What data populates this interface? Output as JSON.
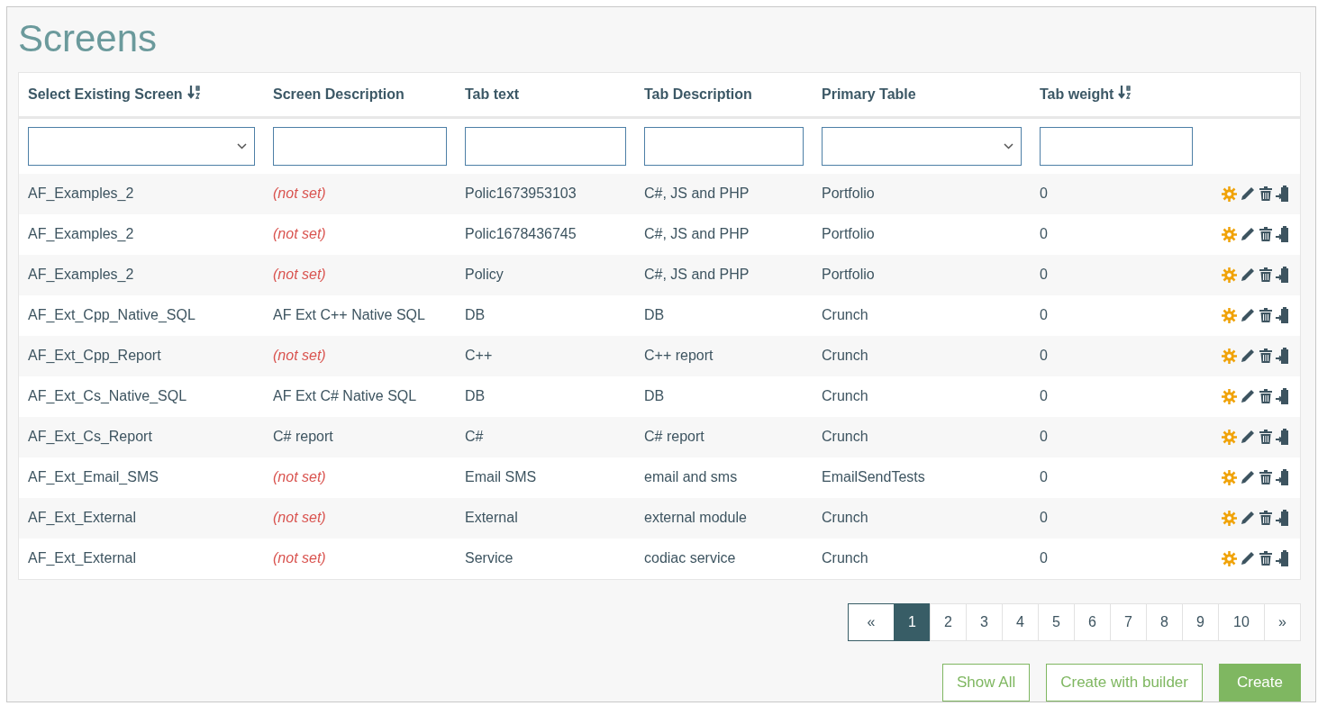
{
  "title": "Screens",
  "columns": [
    {
      "label": "Select Existing Screen",
      "sortable": true,
      "kind": "select"
    },
    {
      "label": "Screen Description",
      "sortable": false,
      "kind": "text"
    },
    {
      "label": "Tab text",
      "sortable": false,
      "kind": "text"
    },
    {
      "label": "Tab Description",
      "sortable": false,
      "kind": "text"
    },
    {
      "label": "Primary Table",
      "sortable": false,
      "kind": "select"
    },
    {
      "label": "Tab weight",
      "sortable": true,
      "kind": "text"
    }
  ],
  "rows": [
    {
      "screen": "AF_Examples_2",
      "description": "(not set)",
      "not_set": true,
      "tab_text": "Polic1673953103",
      "tab_description": "C#, JS and PHP",
      "primary_table": "Portfolio",
      "tab_weight": "0"
    },
    {
      "screen": "AF_Examples_2",
      "description": "(not set)",
      "not_set": true,
      "tab_text": "Polic1678436745",
      "tab_description": "C#, JS and PHP",
      "primary_table": "Portfolio",
      "tab_weight": "0"
    },
    {
      "screen": "AF_Examples_2",
      "description": "(not set)",
      "not_set": true,
      "tab_text": "Policy",
      "tab_description": "C#, JS and PHP",
      "primary_table": "Portfolio",
      "tab_weight": "0"
    },
    {
      "screen": "AF_Ext_Cpp_Native_SQL",
      "description": "AF Ext C++ Native SQL",
      "not_set": false,
      "tab_text": "DB",
      "tab_description": "DB",
      "primary_table": "Crunch",
      "tab_weight": "0"
    },
    {
      "screen": "AF_Ext_Cpp_Report",
      "description": "(not set)",
      "not_set": true,
      "tab_text": "C++",
      "tab_description": "C++ report",
      "primary_table": "Crunch",
      "tab_weight": "0"
    },
    {
      "screen": "AF_Ext_Cs_Native_SQL",
      "description": "AF Ext C# Native SQL",
      "not_set": false,
      "tab_text": "DB",
      "tab_description": "DB",
      "primary_table": "Crunch",
      "tab_weight": "0"
    },
    {
      "screen": "AF_Ext_Cs_Report",
      "description": "C# report",
      "not_set": false,
      "tab_text": "C#",
      "tab_description": "C# report",
      "primary_table": "Crunch",
      "tab_weight": "0"
    },
    {
      "screen": "AF_Ext_Email_SMS",
      "description": "(not set)",
      "not_set": true,
      "tab_text": "Email SMS",
      "tab_description": "email and sms",
      "primary_table": "EmailSendTests",
      "tab_weight": "0"
    },
    {
      "screen": "AF_Ext_External",
      "description": "(not set)",
      "not_set": true,
      "tab_text": "External",
      "tab_description": "external module",
      "primary_table": "Crunch",
      "tab_weight": "0"
    },
    {
      "screen": "AF_Ext_External",
      "description": "(not set)",
      "not_set": true,
      "tab_text": "Service",
      "tab_description": "codiac service",
      "primary_table": "Crunch",
      "tab_weight": "0"
    }
  ],
  "pagination": [
    {
      "label": "«",
      "kind": "prev",
      "selected": false
    },
    {
      "label": "1",
      "kind": "page",
      "selected": true
    },
    {
      "label": "2",
      "kind": "page",
      "selected": false
    },
    {
      "label": "3",
      "kind": "page",
      "selected": false
    },
    {
      "label": "4",
      "kind": "page",
      "selected": false
    },
    {
      "label": "5",
      "kind": "page",
      "selected": false
    },
    {
      "label": "6",
      "kind": "page",
      "selected": false
    },
    {
      "label": "7",
      "kind": "page",
      "selected": false
    },
    {
      "label": "8",
      "kind": "page",
      "selected": false
    },
    {
      "label": "9",
      "kind": "page",
      "selected": false
    },
    {
      "label": "10",
      "kind": "page",
      "selected": false
    },
    {
      "label": "»",
      "kind": "next",
      "selected": false
    }
  ],
  "buttons": [
    {
      "label": "Show All",
      "kind": "outline"
    },
    {
      "label": "Create with builder",
      "kind": "outline"
    },
    {
      "label": "Create",
      "kind": "primary"
    }
  ]
}
